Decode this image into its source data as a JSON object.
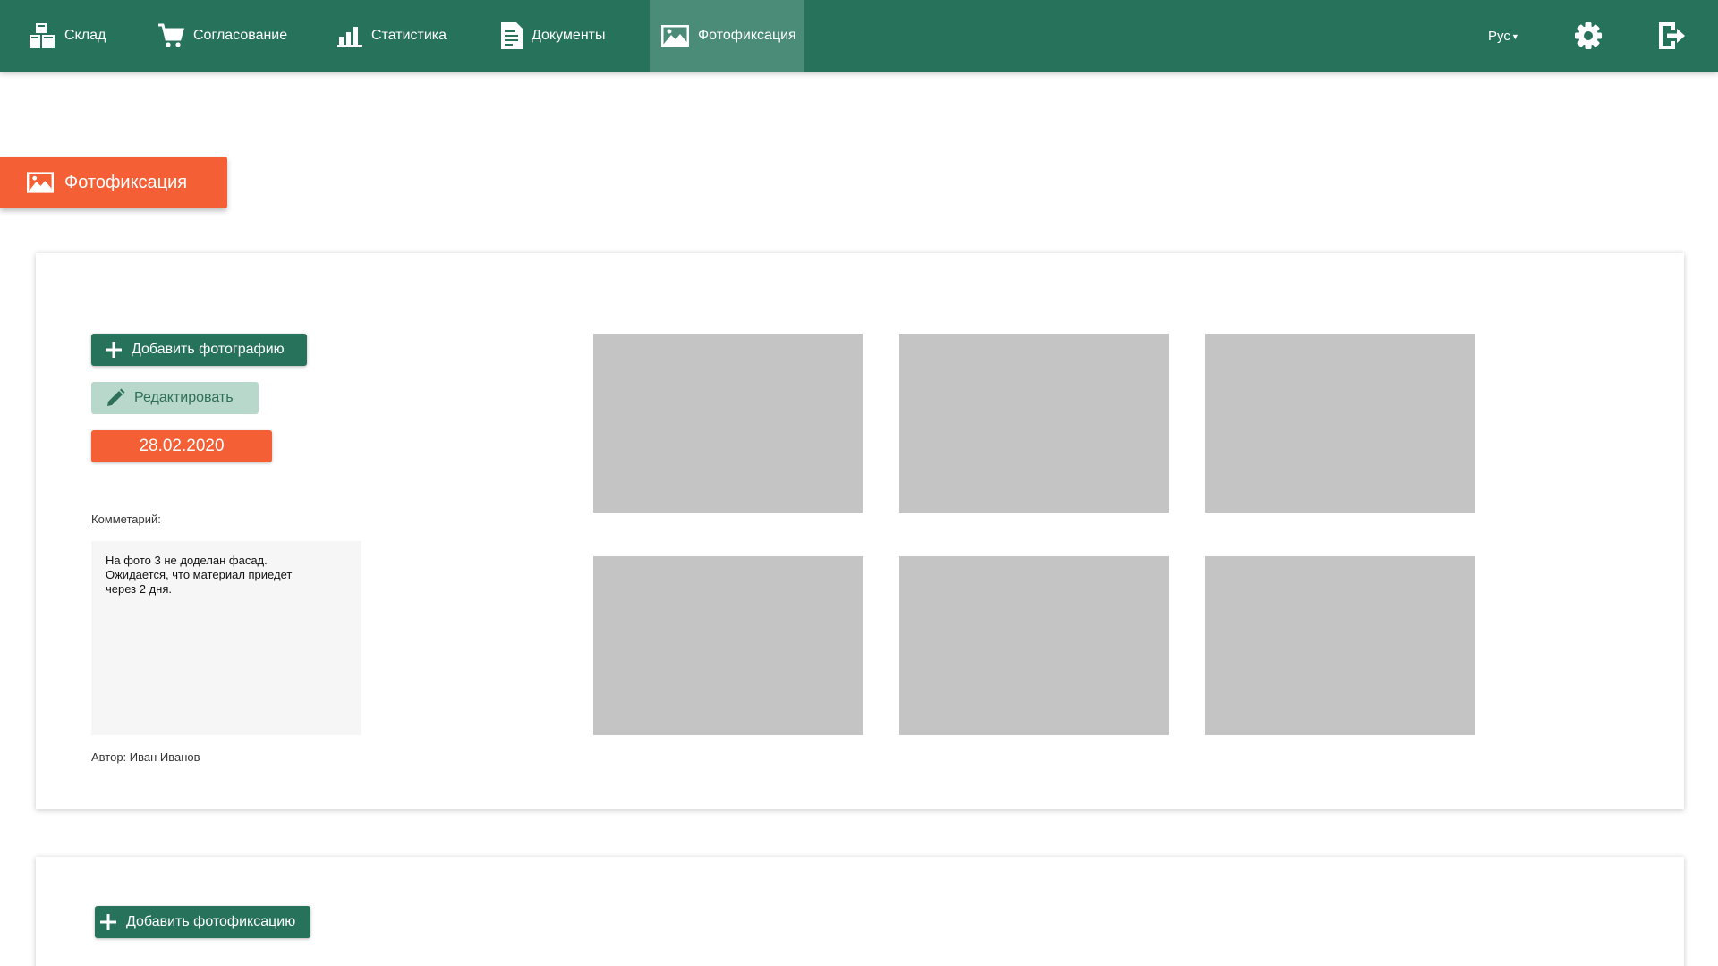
{
  "nav": {
    "items": [
      {
        "label": "Склад",
        "icon": "warehouse-icon"
      },
      {
        "label": "Согласование",
        "icon": "cart-icon"
      },
      {
        "label": "Статистика",
        "icon": "bar-chart-icon"
      },
      {
        "label": "Документы",
        "icon": "document-icon"
      },
      {
        "label": "Фотофиксация",
        "icon": "image-icon",
        "active": true
      }
    ],
    "language": "Рус",
    "settings_icon": "gear-icon",
    "logout_icon": "logout-icon"
  },
  "section": {
    "title": "Фотофиксация",
    "icon": "image-icon"
  },
  "record": {
    "add_photo_label": "Добавить фотографию",
    "edit_label": "Редактировать",
    "date": "28.02.2020",
    "comment_label": "Комметарий:",
    "comment_text": "На фото 3 не доделан фасад.\nОжидается, что материал приедет\nчерез 2 дня.",
    "author": "Автор: Иван Иванов",
    "photo_count": 6
  },
  "footer_card": {
    "add_fixation_label": "Добавить фотофиксацию"
  },
  "colors": {
    "primary_green": "#26725a",
    "active_nav": "#4a8c78",
    "accent_orange": "#f45f35",
    "edit_bg": "#b9d8cc",
    "placeholder_gray": "#c4c4c4"
  }
}
